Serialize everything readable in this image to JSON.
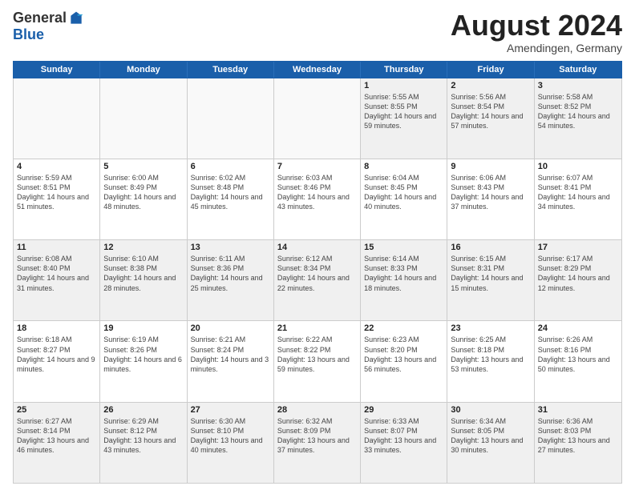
{
  "header": {
    "logo_general": "General",
    "logo_blue": "Blue",
    "title": "August 2024",
    "subtitle": "Amendingen, Germany"
  },
  "calendar": {
    "days_of_week": [
      "Sunday",
      "Monday",
      "Tuesday",
      "Wednesday",
      "Thursday",
      "Friday",
      "Saturday"
    ],
    "weeks": [
      [
        {
          "day": "",
          "empty": true
        },
        {
          "day": "",
          "empty": true
        },
        {
          "day": "",
          "empty": true
        },
        {
          "day": "",
          "empty": true
        },
        {
          "day": "1",
          "sunrise": "5:55 AM",
          "sunset": "8:55 PM",
          "daylight": "14 hours and 59 minutes."
        },
        {
          "day": "2",
          "sunrise": "5:56 AM",
          "sunset": "8:54 PM",
          "daylight": "14 hours and 57 minutes."
        },
        {
          "day": "3",
          "sunrise": "5:58 AM",
          "sunset": "8:52 PM",
          "daylight": "14 hours and 54 minutes."
        }
      ],
      [
        {
          "day": "4",
          "sunrise": "5:59 AM",
          "sunset": "8:51 PM",
          "daylight": "14 hours and 51 minutes."
        },
        {
          "day": "5",
          "sunrise": "6:00 AM",
          "sunset": "8:49 PM",
          "daylight": "14 hours and 48 minutes."
        },
        {
          "day": "6",
          "sunrise": "6:02 AM",
          "sunset": "8:48 PM",
          "daylight": "14 hours and 45 minutes."
        },
        {
          "day": "7",
          "sunrise": "6:03 AM",
          "sunset": "8:46 PM",
          "daylight": "14 hours and 43 minutes."
        },
        {
          "day": "8",
          "sunrise": "6:04 AM",
          "sunset": "8:45 PM",
          "daylight": "14 hours and 40 minutes."
        },
        {
          "day": "9",
          "sunrise": "6:06 AM",
          "sunset": "8:43 PM",
          "daylight": "14 hours and 37 minutes."
        },
        {
          "day": "10",
          "sunrise": "6:07 AM",
          "sunset": "8:41 PM",
          "daylight": "14 hours and 34 minutes."
        }
      ],
      [
        {
          "day": "11",
          "sunrise": "6:08 AM",
          "sunset": "8:40 PM",
          "daylight": "14 hours and 31 minutes."
        },
        {
          "day": "12",
          "sunrise": "6:10 AM",
          "sunset": "8:38 PM",
          "daylight": "14 hours and 28 minutes."
        },
        {
          "day": "13",
          "sunrise": "6:11 AM",
          "sunset": "8:36 PM",
          "daylight": "14 hours and 25 minutes."
        },
        {
          "day": "14",
          "sunrise": "6:12 AM",
          "sunset": "8:34 PM",
          "daylight": "14 hours and 22 minutes."
        },
        {
          "day": "15",
          "sunrise": "6:14 AM",
          "sunset": "8:33 PM",
          "daylight": "14 hours and 18 minutes."
        },
        {
          "day": "16",
          "sunrise": "6:15 AM",
          "sunset": "8:31 PM",
          "daylight": "14 hours and 15 minutes."
        },
        {
          "day": "17",
          "sunrise": "6:17 AM",
          "sunset": "8:29 PM",
          "daylight": "14 hours and 12 minutes."
        }
      ],
      [
        {
          "day": "18",
          "sunrise": "6:18 AM",
          "sunset": "8:27 PM",
          "daylight": "14 hours and 9 minutes."
        },
        {
          "day": "19",
          "sunrise": "6:19 AM",
          "sunset": "8:26 PM",
          "daylight": "14 hours and 6 minutes."
        },
        {
          "day": "20",
          "sunrise": "6:21 AM",
          "sunset": "8:24 PM",
          "daylight": "14 hours and 3 minutes."
        },
        {
          "day": "21",
          "sunrise": "6:22 AM",
          "sunset": "8:22 PM",
          "daylight": "13 hours and 59 minutes."
        },
        {
          "day": "22",
          "sunrise": "6:23 AM",
          "sunset": "8:20 PM",
          "daylight": "13 hours and 56 minutes."
        },
        {
          "day": "23",
          "sunrise": "6:25 AM",
          "sunset": "8:18 PM",
          "daylight": "13 hours and 53 minutes."
        },
        {
          "day": "24",
          "sunrise": "6:26 AM",
          "sunset": "8:16 PM",
          "daylight": "13 hours and 50 minutes."
        }
      ],
      [
        {
          "day": "25",
          "sunrise": "6:27 AM",
          "sunset": "8:14 PM",
          "daylight": "13 hours and 46 minutes."
        },
        {
          "day": "26",
          "sunrise": "6:29 AM",
          "sunset": "8:12 PM",
          "daylight": "13 hours and 43 minutes."
        },
        {
          "day": "27",
          "sunrise": "6:30 AM",
          "sunset": "8:10 PM",
          "daylight": "13 hours and 40 minutes."
        },
        {
          "day": "28",
          "sunrise": "6:32 AM",
          "sunset": "8:09 PM",
          "daylight": "13 hours and 37 minutes."
        },
        {
          "day": "29",
          "sunrise": "6:33 AM",
          "sunset": "8:07 PM",
          "daylight": "13 hours and 33 minutes."
        },
        {
          "day": "30",
          "sunrise": "6:34 AM",
          "sunset": "8:05 PM",
          "daylight": "13 hours and 30 minutes."
        },
        {
          "day": "31",
          "sunrise": "6:36 AM",
          "sunset": "8:03 PM",
          "daylight": "13 hours and 27 minutes."
        }
      ]
    ]
  }
}
